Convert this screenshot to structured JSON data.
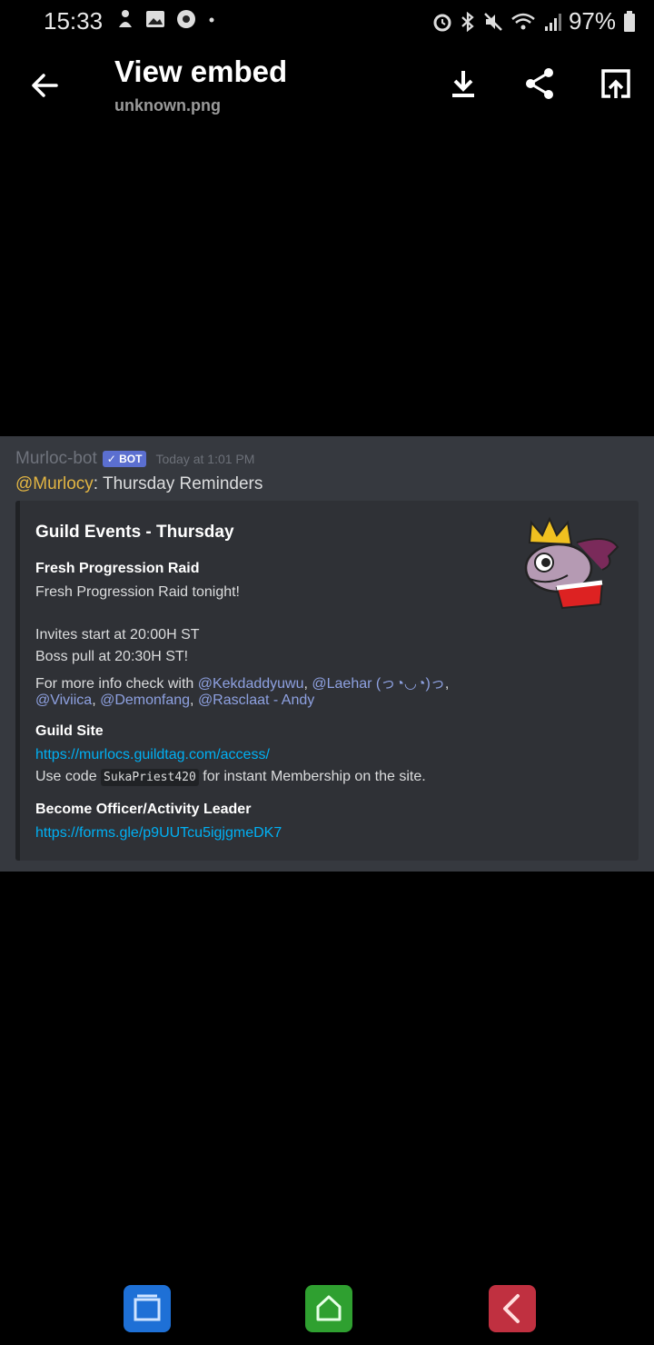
{
  "status_bar": {
    "time": "15:33",
    "battery_percent": "97%"
  },
  "app_bar": {
    "title": "View embed",
    "filename": "unknown.png"
  },
  "message": {
    "author": "Murloc-bot",
    "badge": "✓ BOT",
    "timestamp": "Today at 1:01 PM",
    "mention": "@Murlocy",
    "text": ": Thursday Reminders"
  },
  "embed": {
    "title": "Guild Events - Thursday",
    "field1_name": "Fresh Progression Raid",
    "field1_line1": "Fresh Progression Raid tonight!",
    "field1_line2": "Invites start at 20:00H ST",
    "field1_line3": "Boss pull at 20:30H ST!",
    "field1_line4_prefix": "For more info check with ",
    "mentions_row1": [
      "@Kekdaddyuwu",
      "@Laehar (っ◔◡◔)っ"
    ],
    "mentions_row2": [
      "@Viviica",
      "@Demonfang",
      "@Rasclaat - Andy"
    ],
    "field2_name": "Guild Site",
    "field2_link": "https://murlocs.guildtag.com/access/",
    "field2_text_prefix": "Use code ",
    "field2_code": "SukaPriest420",
    "field2_text_suffix": " for instant Membership on the site.",
    "field3_name": "Become Officer/Activity Leader",
    "field3_link": "https://forms.gle/p9UUTcu5igjgmeDK7"
  },
  "icons": {
    "back": "arrow-left-icon",
    "download": "download-icon",
    "share": "share-icon",
    "open": "open-in-new-icon",
    "thumbnail": "murloc-king-thumbnail"
  },
  "colors": {
    "link": "#00b0f4",
    "mention": "#8ea1e1",
    "mention_highlight": "#e2b543",
    "bot_badge": "#5b6fd0"
  }
}
